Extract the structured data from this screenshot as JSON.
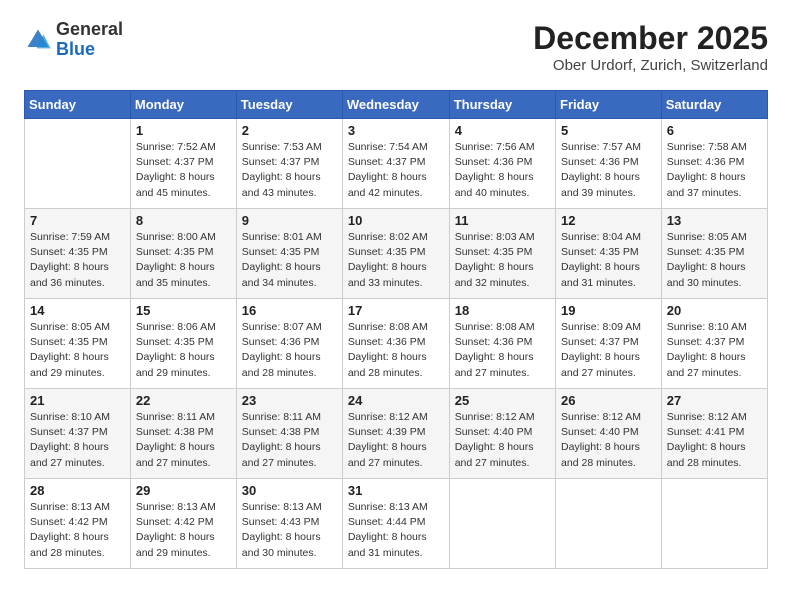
{
  "logo": {
    "general": "General",
    "blue": "Blue"
  },
  "header": {
    "month": "December 2025",
    "location": "Ober Urdorf, Zurich, Switzerland"
  },
  "days_of_week": [
    "Sunday",
    "Monday",
    "Tuesday",
    "Wednesday",
    "Thursday",
    "Friday",
    "Saturday"
  ],
  "weeks": [
    [
      {
        "day": "",
        "info": ""
      },
      {
        "day": "1",
        "info": "Sunrise: 7:52 AM\nSunset: 4:37 PM\nDaylight: 8 hours\nand 45 minutes."
      },
      {
        "day": "2",
        "info": "Sunrise: 7:53 AM\nSunset: 4:37 PM\nDaylight: 8 hours\nand 43 minutes."
      },
      {
        "day": "3",
        "info": "Sunrise: 7:54 AM\nSunset: 4:37 PM\nDaylight: 8 hours\nand 42 minutes."
      },
      {
        "day": "4",
        "info": "Sunrise: 7:56 AM\nSunset: 4:36 PM\nDaylight: 8 hours\nand 40 minutes."
      },
      {
        "day": "5",
        "info": "Sunrise: 7:57 AM\nSunset: 4:36 PM\nDaylight: 8 hours\nand 39 minutes."
      },
      {
        "day": "6",
        "info": "Sunrise: 7:58 AM\nSunset: 4:36 PM\nDaylight: 8 hours\nand 37 minutes."
      }
    ],
    [
      {
        "day": "7",
        "info": "Sunrise: 7:59 AM\nSunset: 4:35 PM\nDaylight: 8 hours\nand 36 minutes."
      },
      {
        "day": "8",
        "info": "Sunrise: 8:00 AM\nSunset: 4:35 PM\nDaylight: 8 hours\nand 35 minutes."
      },
      {
        "day": "9",
        "info": "Sunrise: 8:01 AM\nSunset: 4:35 PM\nDaylight: 8 hours\nand 34 minutes."
      },
      {
        "day": "10",
        "info": "Sunrise: 8:02 AM\nSunset: 4:35 PM\nDaylight: 8 hours\nand 33 minutes."
      },
      {
        "day": "11",
        "info": "Sunrise: 8:03 AM\nSunset: 4:35 PM\nDaylight: 8 hours\nand 32 minutes."
      },
      {
        "day": "12",
        "info": "Sunrise: 8:04 AM\nSunset: 4:35 PM\nDaylight: 8 hours\nand 31 minutes."
      },
      {
        "day": "13",
        "info": "Sunrise: 8:05 AM\nSunset: 4:35 PM\nDaylight: 8 hours\nand 30 minutes."
      }
    ],
    [
      {
        "day": "14",
        "info": "Sunrise: 8:05 AM\nSunset: 4:35 PM\nDaylight: 8 hours\nand 29 minutes."
      },
      {
        "day": "15",
        "info": "Sunrise: 8:06 AM\nSunset: 4:35 PM\nDaylight: 8 hours\nand 29 minutes."
      },
      {
        "day": "16",
        "info": "Sunrise: 8:07 AM\nSunset: 4:36 PM\nDaylight: 8 hours\nand 28 minutes."
      },
      {
        "day": "17",
        "info": "Sunrise: 8:08 AM\nSunset: 4:36 PM\nDaylight: 8 hours\nand 28 minutes."
      },
      {
        "day": "18",
        "info": "Sunrise: 8:08 AM\nSunset: 4:36 PM\nDaylight: 8 hours\nand 27 minutes."
      },
      {
        "day": "19",
        "info": "Sunrise: 8:09 AM\nSunset: 4:37 PM\nDaylight: 8 hours\nand 27 minutes."
      },
      {
        "day": "20",
        "info": "Sunrise: 8:10 AM\nSunset: 4:37 PM\nDaylight: 8 hours\nand 27 minutes."
      }
    ],
    [
      {
        "day": "21",
        "info": "Sunrise: 8:10 AM\nSunset: 4:37 PM\nDaylight: 8 hours\nand 27 minutes."
      },
      {
        "day": "22",
        "info": "Sunrise: 8:11 AM\nSunset: 4:38 PM\nDaylight: 8 hours\nand 27 minutes."
      },
      {
        "day": "23",
        "info": "Sunrise: 8:11 AM\nSunset: 4:38 PM\nDaylight: 8 hours\nand 27 minutes."
      },
      {
        "day": "24",
        "info": "Sunrise: 8:12 AM\nSunset: 4:39 PM\nDaylight: 8 hours\nand 27 minutes."
      },
      {
        "day": "25",
        "info": "Sunrise: 8:12 AM\nSunset: 4:40 PM\nDaylight: 8 hours\nand 27 minutes."
      },
      {
        "day": "26",
        "info": "Sunrise: 8:12 AM\nSunset: 4:40 PM\nDaylight: 8 hours\nand 28 minutes."
      },
      {
        "day": "27",
        "info": "Sunrise: 8:12 AM\nSunset: 4:41 PM\nDaylight: 8 hours\nand 28 minutes."
      }
    ],
    [
      {
        "day": "28",
        "info": "Sunrise: 8:13 AM\nSunset: 4:42 PM\nDaylight: 8 hours\nand 28 minutes."
      },
      {
        "day": "29",
        "info": "Sunrise: 8:13 AM\nSunset: 4:42 PM\nDaylight: 8 hours\nand 29 minutes."
      },
      {
        "day": "30",
        "info": "Sunrise: 8:13 AM\nSunset: 4:43 PM\nDaylight: 8 hours\nand 30 minutes."
      },
      {
        "day": "31",
        "info": "Sunrise: 8:13 AM\nSunset: 4:44 PM\nDaylight: 8 hours\nand 31 minutes."
      },
      {
        "day": "",
        "info": ""
      },
      {
        "day": "",
        "info": ""
      },
      {
        "day": "",
        "info": ""
      }
    ]
  ]
}
